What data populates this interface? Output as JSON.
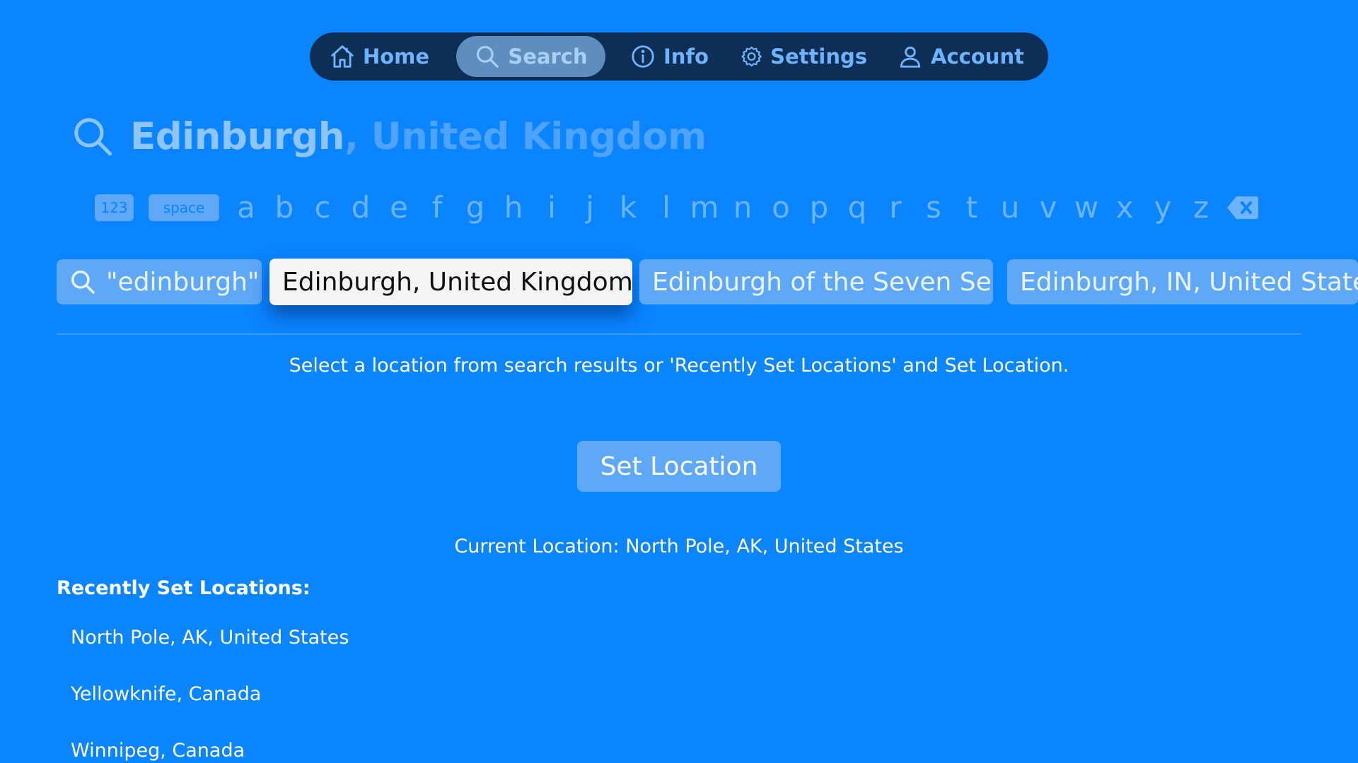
{
  "nav": {
    "items": [
      {
        "label": "Home",
        "icon": "house-icon"
      },
      {
        "label": "Search",
        "icon": "magnifier-icon",
        "active": true
      },
      {
        "label": "Info",
        "icon": "info-circle-icon"
      },
      {
        "label": "Settings",
        "icon": "gear-icon"
      },
      {
        "label": "Account",
        "icon": "person-icon"
      }
    ]
  },
  "search": {
    "typed": "Edinburgh",
    "suggestion": ", United Kingdom"
  },
  "keyboard": {
    "numbers_label": "123",
    "space_label": "space",
    "letters": [
      "a",
      "b",
      "c",
      "d",
      "e",
      "f",
      "g",
      "h",
      "i",
      "j",
      "k",
      "l",
      "m",
      "n",
      "o",
      "p",
      "q",
      "r",
      "s",
      "t",
      "u",
      "v",
      "w",
      "x",
      "y",
      "z"
    ],
    "delete_icon": "delete-backspace-icon"
  },
  "results": {
    "query_chip": "\"edinburgh\"",
    "items": [
      "Edinburgh, United Kingdom",
      "Edinburgh of the Seven Seas",
      "Edinburgh, IN, United States"
    ],
    "focused_index": 0
  },
  "instruction": "Select a location from search results or 'Recently Set Locations' and Set Location.",
  "set_location_label": "Set Location",
  "current_location": "Current Location: North Pole, AK, United States",
  "recent": {
    "title": "Recently Set Locations:",
    "items": [
      "North Pole, AK, United States",
      "Yellowknife, Canada",
      "Winnipeg, Canada"
    ]
  },
  "colors": {
    "background": "#0A84FF",
    "nav_background": "#0D2F55",
    "chip": "#5FA8F7",
    "focused_chip": "#F4F4F6"
  }
}
